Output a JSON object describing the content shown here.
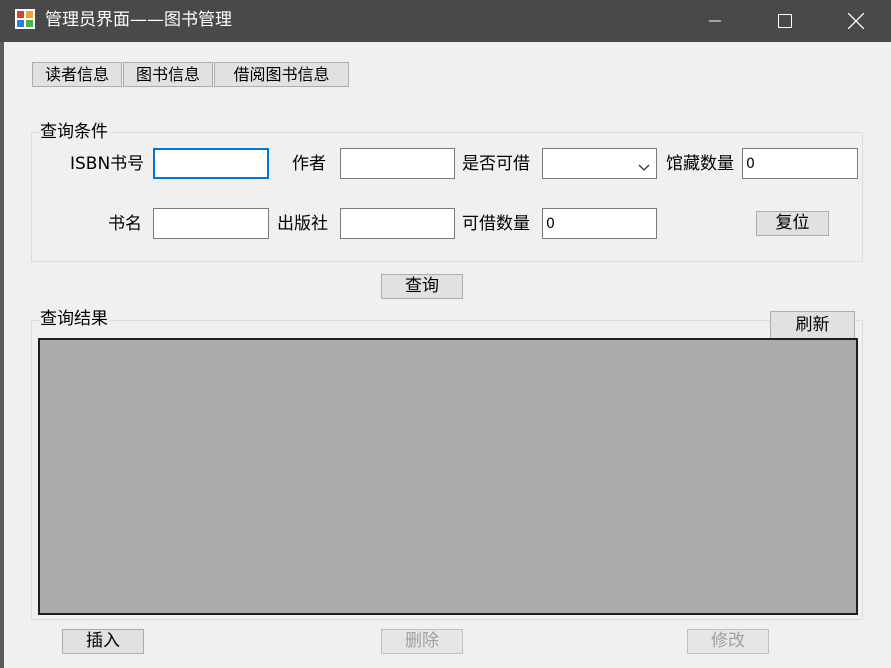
{
  "window": {
    "title": "管理员界面——图书管理",
    "icons": {
      "app": "app-icon",
      "minimize": "minimize-icon",
      "maximize": "maximize-icon",
      "close": "close-icon"
    }
  },
  "tabs": [
    "读者信息",
    "图书信息",
    "借阅图书信息"
  ],
  "query_group": {
    "legend": "查询条件",
    "isbn_label": "ISBN书号",
    "isbn_value": "",
    "author_label": "作者",
    "author_value": "",
    "borrowable_label": "是否可借",
    "borrowable_value": "",
    "collection_count_label": "馆藏数量",
    "collection_count_value": "0",
    "title_label": "书名",
    "title_value": "",
    "publisher_label": "出版社",
    "publisher_value": "",
    "available_count_label": "可借数量",
    "available_count_value": "0",
    "reset_label": "复位"
  },
  "query_button_label": "查询",
  "results_group": {
    "legend": "查询结果",
    "refresh_label": "刷新"
  },
  "actions": {
    "insert_label": "插入",
    "delete_label": "删除",
    "modify_label": "修改"
  }
}
